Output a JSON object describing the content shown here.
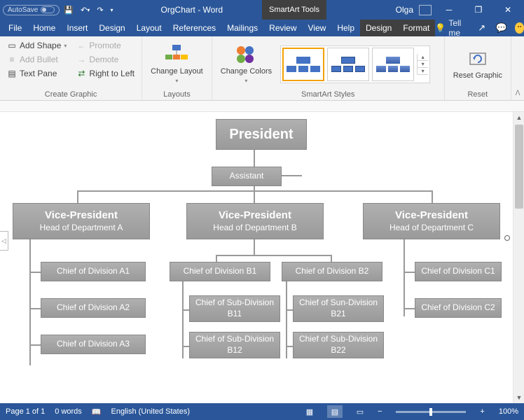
{
  "titlebar": {
    "autosave": "AutoSave",
    "doc_title": "OrgChart - Word",
    "context_tab": "SmartArt Tools",
    "user": "Olga"
  },
  "tabs": {
    "file": "File",
    "home": "Home",
    "insert": "Insert",
    "design": "Design",
    "layout": "Layout",
    "references": "References",
    "mailings": "Mailings",
    "review": "Review",
    "view": "View",
    "help": "Help",
    "sa_design": "Design",
    "sa_format": "Format",
    "tell_me": "Tell me"
  },
  "ribbon": {
    "create_graphic": {
      "label": "Create Graphic",
      "add_shape": "Add Shape",
      "add_bullet": "Add Bullet",
      "text_pane": "Text Pane",
      "promote": "Promote",
      "demote": "Demote",
      "right_to_left": "Right to Left"
    },
    "layouts": {
      "label": "Layouts",
      "change_layout": "Change Layout"
    },
    "styles": {
      "label": "SmartArt Styles",
      "change_colors": "Change Colors"
    },
    "reset": {
      "label": "Reset",
      "reset_graphic": "Reset Graphic"
    }
  },
  "chart": {
    "president": "President",
    "assistant": "Assistant",
    "vp": "Vice-President",
    "dept_a": "Head of Department A",
    "dept_b": "Head of Department B",
    "dept_c": "Head of Department C",
    "a1": "Chief of Division A1",
    "a2": "Chief of Division A2",
    "a3": "Chief of Division A3",
    "b1": "Chief of Division B1",
    "b2": "Chief of Division B2",
    "b11": "Chief of Sub-Division B11",
    "b12": "Chief of Sub-Division B12",
    "b21": "Chief of Sun-Division B21",
    "b22": "Chief of Sub-Division B22",
    "c1": "Chief of Division C1",
    "c2": "Chief of Division C2"
  },
  "status": {
    "page": "Page 1 of 1",
    "words": "0 words",
    "lang": "English (United States)",
    "zoom": "100%"
  }
}
